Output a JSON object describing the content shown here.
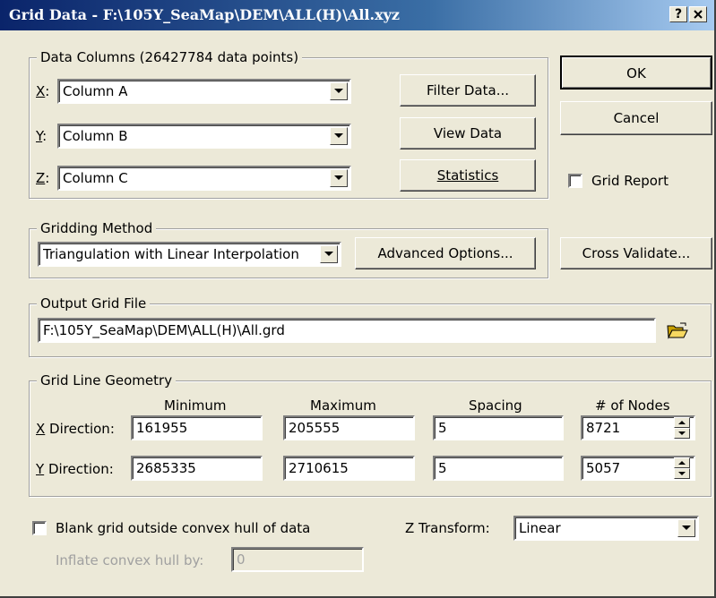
{
  "window": {
    "title": "Grid Data - F:\\105Y_SeaMap\\DEM\\ALL(H)\\All.xyz",
    "help": "?",
    "close": "X"
  },
  "data_columns": {
    "legend": "Data Columns   (26427784 data points)",
    "x_label": "X:",
    "x_value": "Column A",
    "y_label": "Y:",
    "y_value": "Column B",
    "z_label": "Z:",
    "z_value": "Column C",
    "filter_button": "Filter Data...",
    "view_button": "View Data",
    "stats_button": "Statistics"
  },
  "buttons": {
    "ok": "OK",
    "cancel": "Cancel",
    "cross_validate": "Cross Validate..."
  },
  "grid_report": {
    "label": "Grid Report",
    "checked": false
  },
  "gridding_method": {
    "legend": "Gridding Method",
    "value": "Triangulation with Linear Interpolation",
    "advanced_button": "Advanced Options..."
  },
  "output_grid": {
    "legend": "Output Grid File",
    "path": "F:\\105Y_SeaMap\\DEM\\ALL(H)\\All.grd",
    "browse_icon": "folder-open-icon"
  },
  "geometry": {
    "legend": "Grid Line Geometry",
    "headers": {
      "minimum": "Minimum",
      "maximum": "Maximum",
      "spacing": "Spacing",
      "nodes": "# of Nodes"
    },
    "x": {
      "label": "X Direction:",
      "min": "161955",
      "max": "205555",
      "spacing": "5",
      "nodes": "8721"
    },
    "y": {
      "label": "Y Direction:",
      "min": "2685335",
      "max": "2710615",
      "spacing": "5",
      "nodes": "5057"
    }
  },
  "blank_grid": {
    "label": "Blank grid outside convex hull of data",
    "checked": false
  },
  "inflate": {
    "label": "Inflate convex hull by:",
    "value": "0"
  },
  "z_transform": {
    "label": "Z Transform:",
    "value": "Linear"
  }
}
